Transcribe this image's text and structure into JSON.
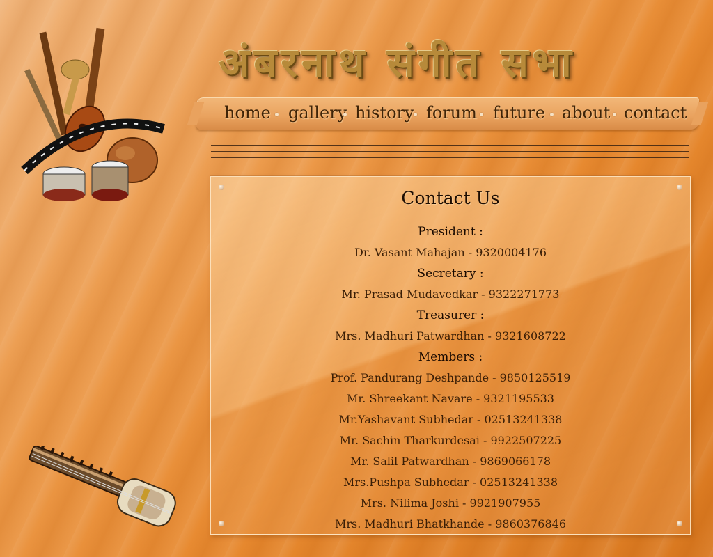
{
  "header": {
    "site_title": "अंबरनाथ संगीत सभा"
  },
  "nav": {
    "items": [
      {
        "label": "home"
      },
      {
        "label": "gallery"
      },
      {
        "label": "history"
      },
      {
        "label": "forum"
      },
      {
        "label": "future"
      },
      {
        "label": "about"
      },
      {
        "label": "contact"
      }
    ]
  },
  "contact": {
    "title": "Contact Us",
    "president_heading": "President :",
    "president": "Dr. Vasant Mahajan - 9320004176",
    "secretary_heading": "Secretary :",
    "secretary": "Mr. Prasad Mudavedkar - 9322271773",
    "treasurer_heading": "Treasurer :",
    "treasurer": "Mrs. Madhuri Patwardhan - 9321608722",
    "members_heading": "Members :",
    "members": [
      "Prof. Pandurang Deshpande - 9850125519",
      "Mr. Shreekant Navare - 9321195533",
      "Mr.Yashavant Subhedar - 02513241338",
      "Mr. Sachin Tharkurdesai - 9922507225",
      "Mr. Salil Patwardhan - 9869066178",
      "Mrs.Pushpa  Subhedar - 02513241338",
      "Mrs. Nilima Joshi - 9921907955",
      "Mrs. Madhuri Bhatkhande - 9860376846"
    ]
  },
  "icons": {
    "logo": "musical-instruments-logo-icon",
    "footer_art": "sarangi-instrument-icon",
    "nav_separator": "bullet-dot-icon"
  },
  "colors": {
    "background": "#e7892f",
    "title_gold": "#b78a3a",
    "nav_text": "#3f2408",
    "panel_text": "#3a1e06"
  }
}
